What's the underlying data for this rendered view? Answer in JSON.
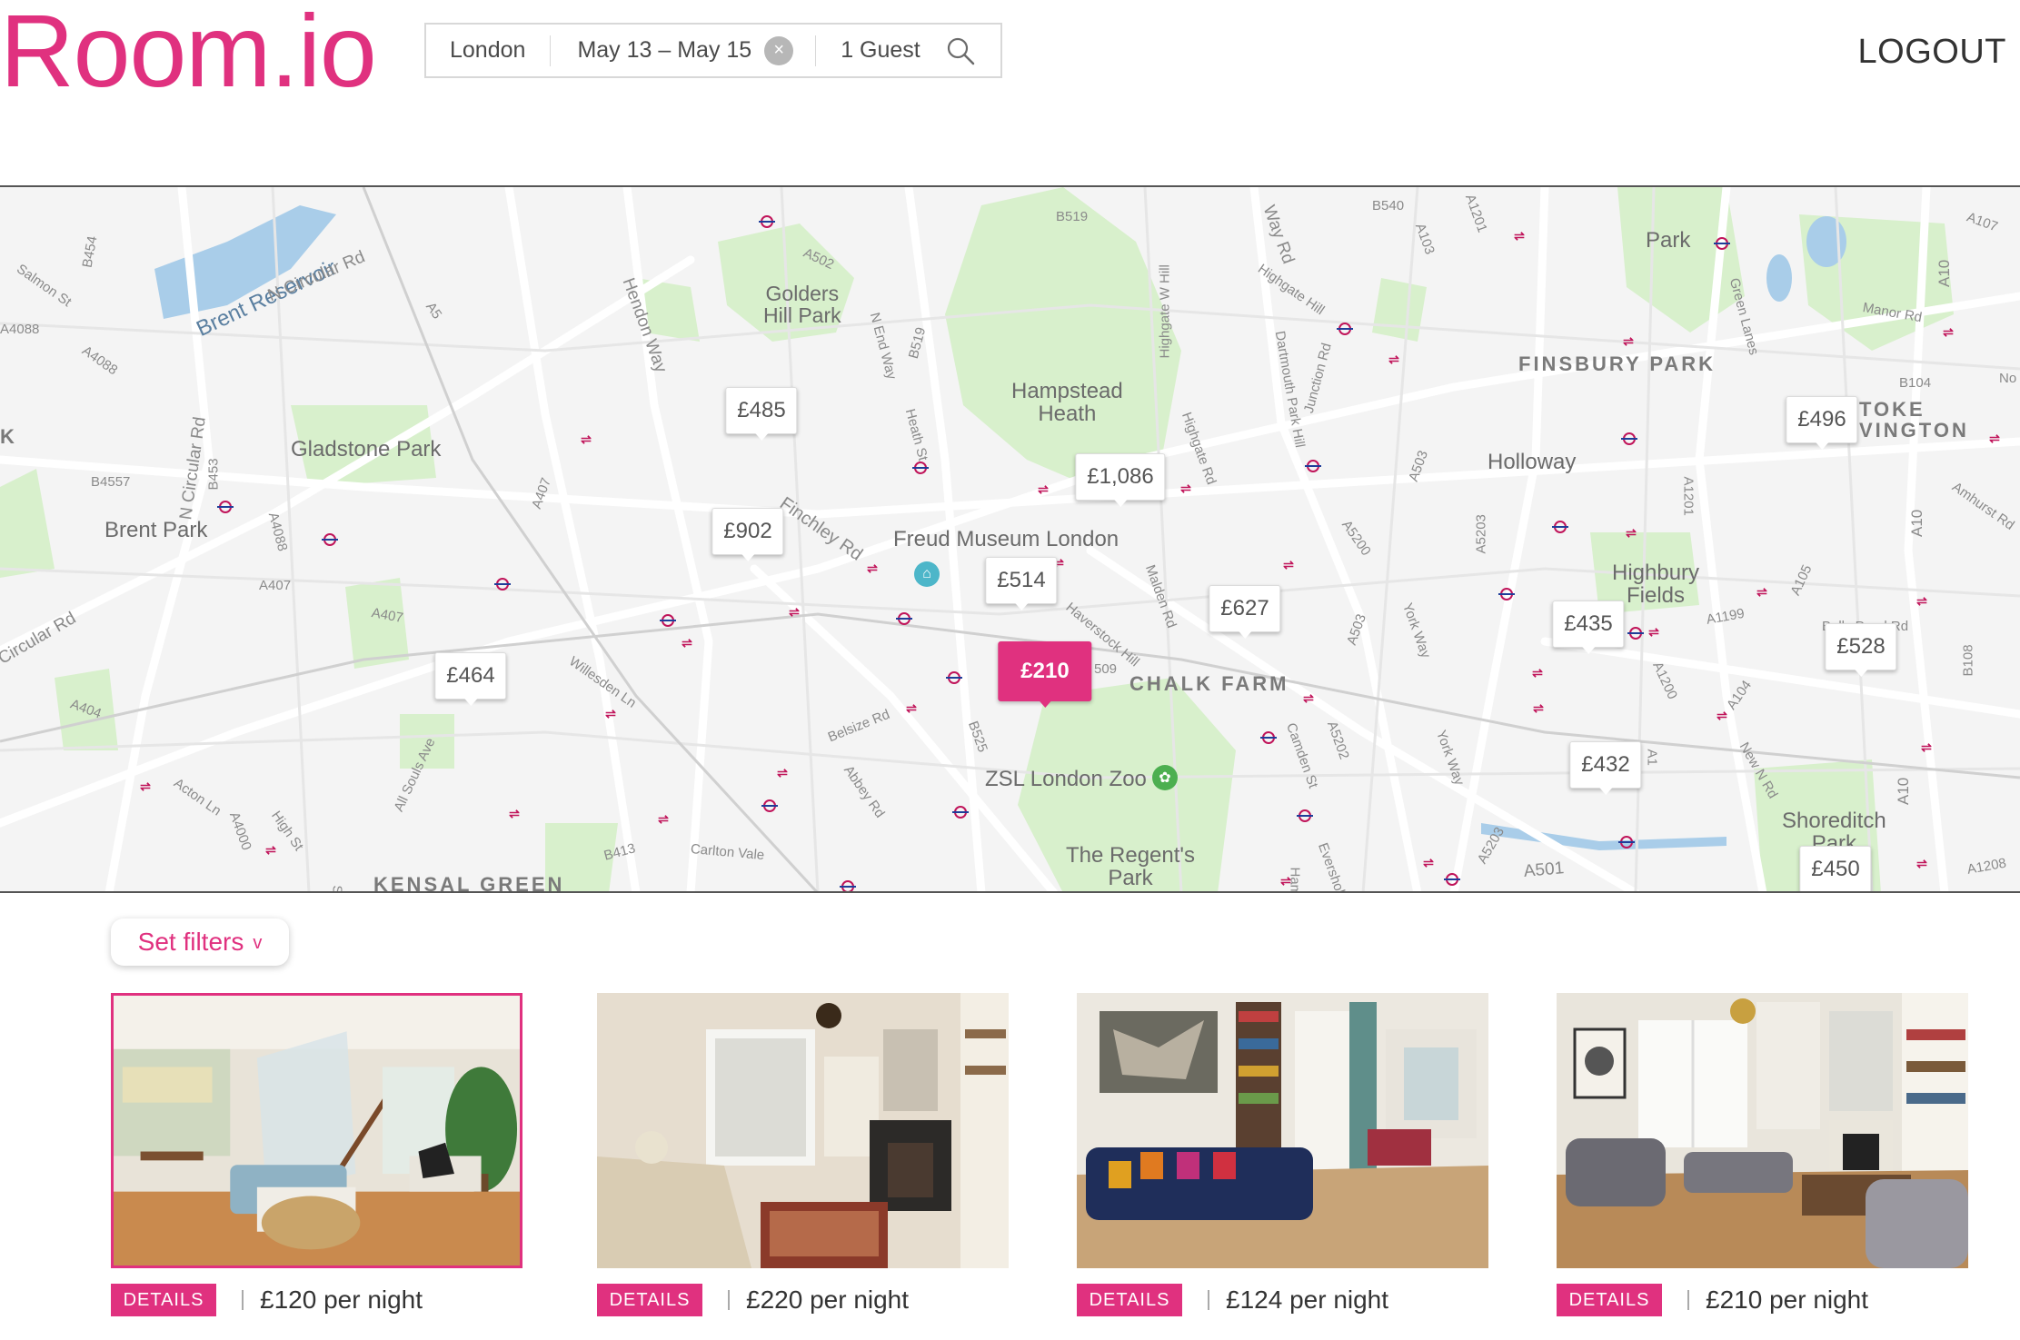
{
  "app": {
    "logo": "Room.io"
  },
  "search": {
    "location": "London",
    "dates": "May 13 – May 15",
    "clear_icon": "×",
    "guests": "1 Guest",
    "search_icon": "search-icon"
  },
  "header": {
    "logout": "LOGOUT"
  },
  "map": {
    "labels": {
      "golders_hill_park": "Golders\nHill Park",
      "hampstead_heath": "Hampstead\nHeath",
      "gladstone_park": "Gladstone Park",
      "brent_park": "Brent Park",
      "freud_museum": "Freud Museum London",
      "chalk_farm": "CHALK FARM",
      "zsl_zoo": "ZSL London Zoo",
      "regents_park": "The Regent's\nPark",
      "kensal_green": "KENSAL GREEN",
      "finsbury_park": "FINSBURY PARK",
      "holloway": "Holloway",
      "highbury_fields": "Highbury\nFields",
      "stoke_newington": "TOKE\nVINGTON",
      "shoreditch_park": "Shoreditch\nPark",
      "park_ne": "Park",
      "k_edge": "K",
      "brent_reservoir": "Brent Reservoir"
    },
    "roads": {
      "n_circular_rd_top": "N Circular Rd",
      "n_circular_rd_left": "N Circular Rd",
      "circular_rd_bottom": "Circular Rd",
      "hendon_way": "Hendon Way",
      "finchley_rd": "Finchley Rd",
      "salmon_st": "Salmon St",
      "a4088_a": "A4088",
      "a4088_b": "A4088",
      "b454": "B454",
      "a5": "A5",
      "a502": "A502",
      "b519_top": "B519",
      "b540": "B540",
      "a103": "A103",
      "a1201": "A1201",
      "a107": "A107",
      "a10_top": "A10",
      "manor_rd": "Manor Rd",
      "green_lanes": "Green Lanes",
      "b104": "B104",
      "b4557": "B4557",
      "b453": "B453",
      "a407_a": "A407",
      "a407_b": "A407",
      "a407_c": "A407",
      "a404": "A404",
      "a4088_c": "A4088",
      "willesden_ln": "Willesden Ln",
      "belsize_rd": "Belsize Rd",
      "abbey_rd": "Abbey Rd",
      "b525": "B525",
      "carlton_vale": "Carlton Vale",
      "b413": "B413",
      "acton_ln": "Acton Ln",
      "a4000": "A4000",
      "high_st": "High St",
      "all_souls_ave": "All Souls Ave",
      "haverstock_hill": "Haverstock Hill",
      "malden_rd": "Malden Rd",
      "heath_st": "Heath St",
      "n_end_way": "N End Way",
      "b519_mid": "B519",
      "highgate_w_hill": "Highgate W Hill",
      "highgate_rd": "Highgate Rd",
      "dartmouth_park_hill": "Dartmouth Park Hill",
      "junction_rd": "Junction Rd",
      "a5200": "A5200",
      "a503_a": "A503",
      "a503_b": "A503",
      "york_way_a": "York Way",
      "york_way_b": "York Way",
      "camden_st": "Camden St",
      "a5202": "A5202",
      "eversholt_st": "Eversholt St",
      "a5203_a": "A5203",
      "a5203_b": "A5203",
      "a501": "A501",
      "a1200": "A1200",
      "a1": "A1",
      "a104": "A104",
      "new_n_rd": "New N Rd",
      "a105": "A105",
      "a1199": "A1199",
      "balls_pond_rd": "Balls Pond Rd",
      "b108": "B108",
      "a10_mid": "A10",
      "a10_bottom": "A10",
      "a1208": "A1208",
      "a1201_b": "A1201",
      "amhurst_rd": "Amhurst Rd",
      "highgate_hill": "Highgate Hill",
      "way_rd": "Way Rd",
      "scrub": "Scrub",
      "hamp": "Hamp",
      "b509": "509",
      "no_edge": "No"
    },
    "pins": [
      {
        "price": "£485"
      },
      {
        "price": "£902"
      },
      {
        "price": "£1,086"
      },
      {
        "price": "£514"
      },
      {
        "price": "£627"
      },
      {
        "price": "£464"
      },
      {
        "price": "£210",
        "active": true
      },
      {
        "price": "£496"
      },
      {
        "price": "£435"
      },
      {
        "price": "£528"
      },
      {
        "price": "£432"
      },
      {
        "price": "£450"
      }
    ]
  },
  "filters": {
    "label": "Set filters",
    "chevron": "v"
  },
  "listings": [
    {
      "price": "£120 per night",
      "details": "DETAILS",
      "selected": true
    },
    {
      "price": "£220 per night",
      "details": "DETAILS"
    },
    {
      "price": "£124 per night",
      "details": "DETAILS"
    },
    {
      "price": "£210 per night",
      "details": "DETAILS"
    }
  ],
  "colors": {
    "accent": "#e0317f",
    "map_park": "#d8f0cc",
    "map_water": "#a9cde9"
  }
}
